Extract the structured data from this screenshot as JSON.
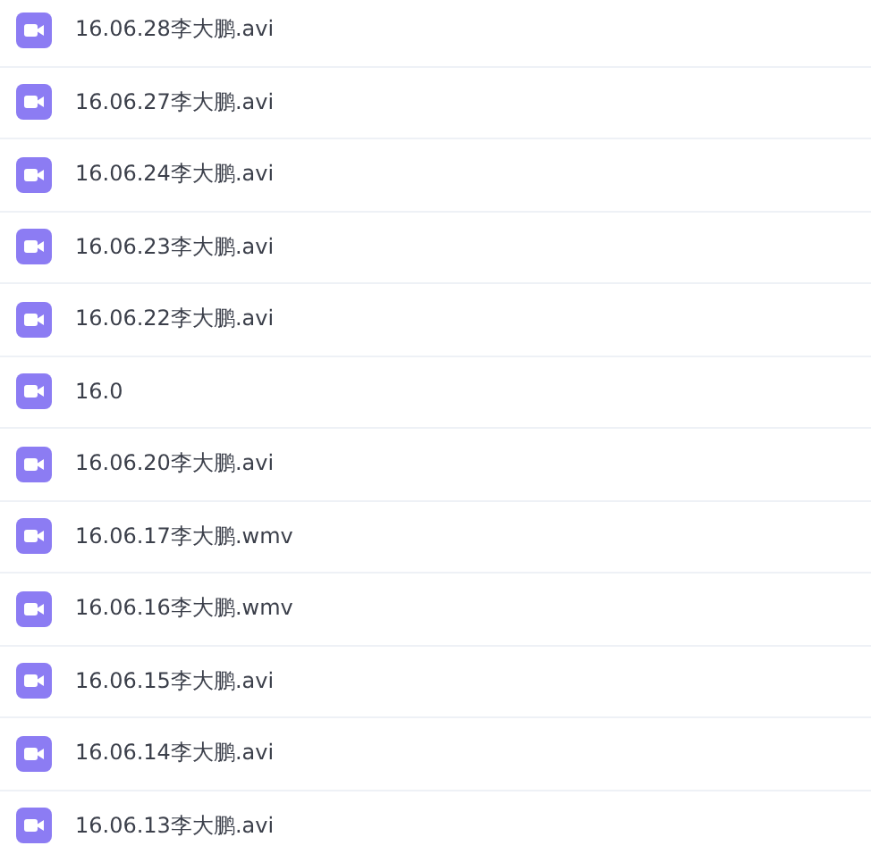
{
  "files": [
    {
      "name": "16.06.28李大鹏.avi"
    },
    {
      "name": "16.06.27李大鹏.avi"
    },
    {
      "name": "16.06.24李大鹏.avi"
    },
    {
      "name": "16.06.23李大鹏.avi"
    },
    {
      "name": "16.06.22李大鹏.avi"
    },
    {
      "name": "16.0"
    },
    {
      "name": "16.06.20李大鹏.avi"
    },
    {
      "name": "16.06.17李大鹏.wmv"
    },
    {
      "name": "16.06.16李大鹏.wmv"
    },
    {
      "name": "16.06.15李大鹏.avi"
    },
    {
      "name": "16.06.14李大鹏.avi"
    },
    {
      "name": "16.06.13李大鹏.avi"
    }
  ]
}
